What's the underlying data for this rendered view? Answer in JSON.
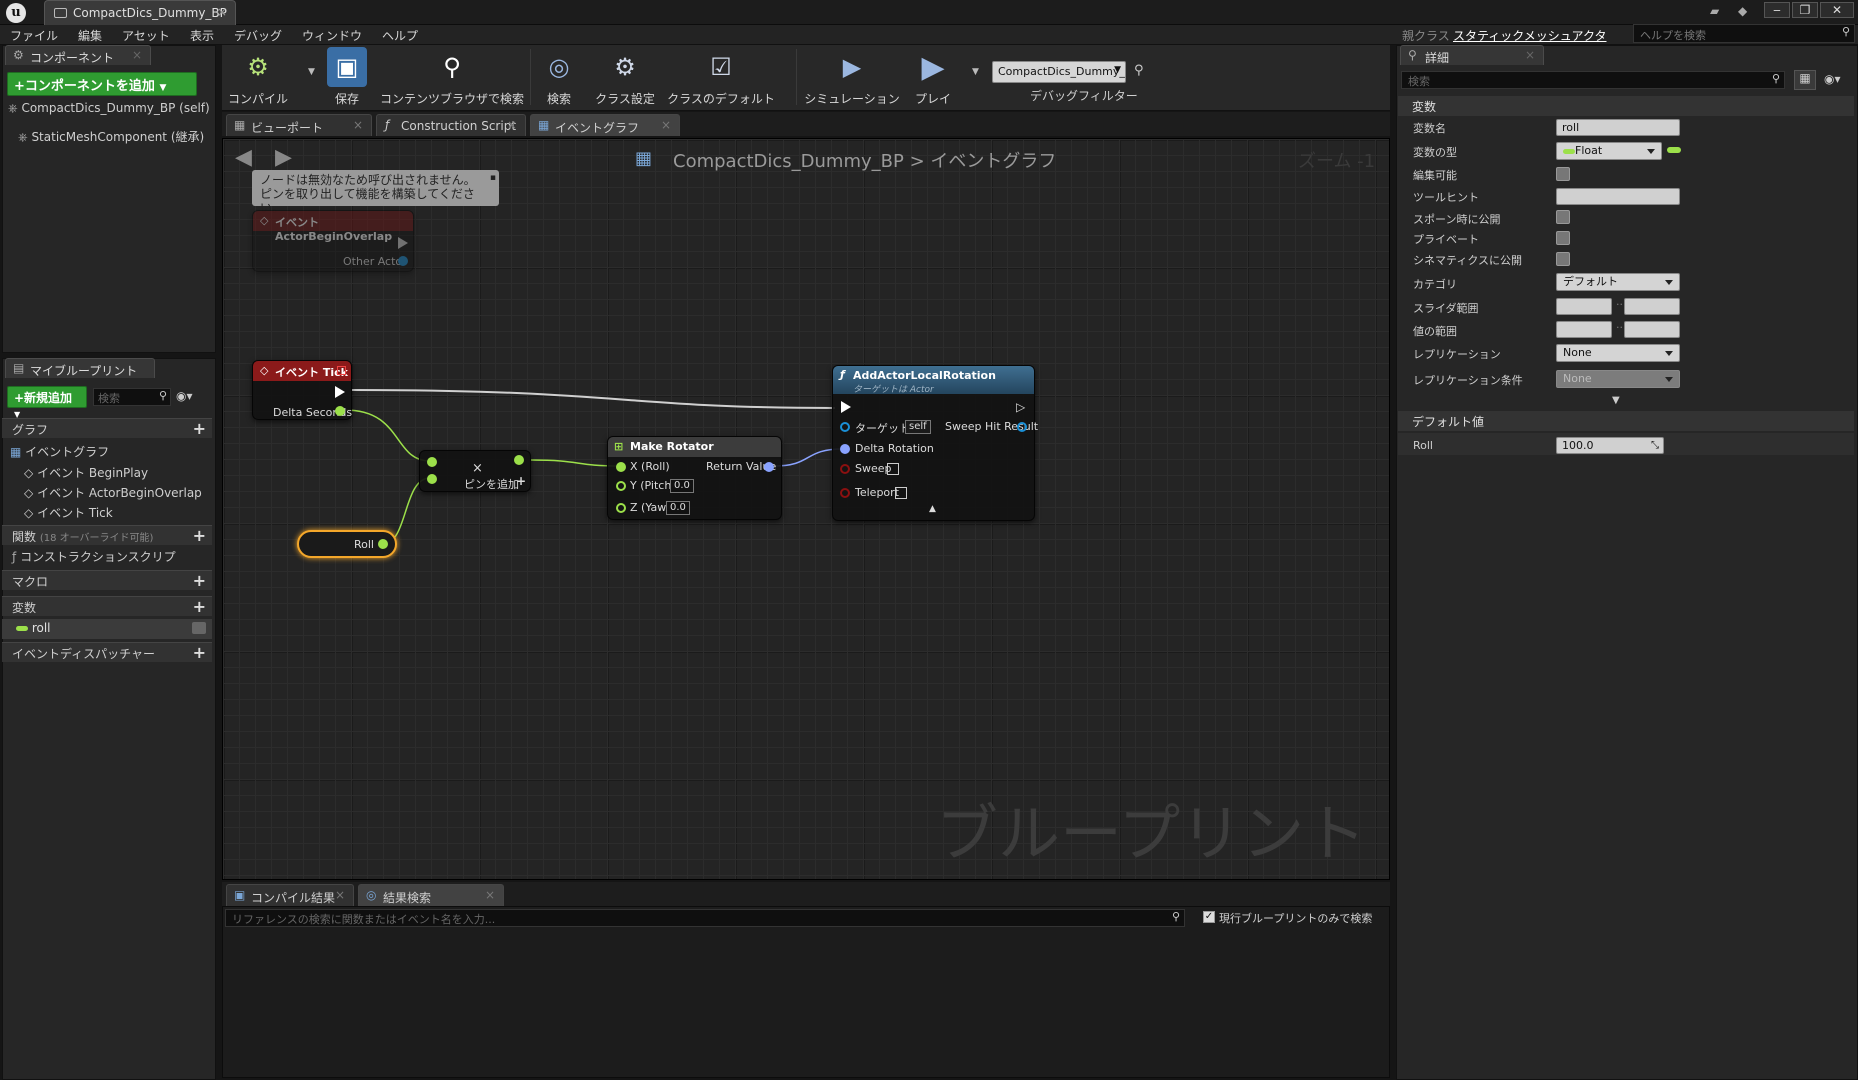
{
  "window": {
    "tab_title": "CompactDics_Dummy_BP",
    "tab_close": "×",
    "parent_class_label": "親クラス",
    "parent_class_value": "スタティックメッシュアクタ",
    "help_search_placeholder": "ヘルプを検索"
  },
  "menu": [
    "ファイル",
    "編集",
    "アセット",
    "表示",
    "デバッグ",
    "ウィンドウ",
    "ヘルプ"
  ],
  "components": {
    "tab": "コンポーネント",
    "add_button": "+コンポーネントを追加",
    "items": [
      "CompactDics_Dummy_BP (self)",
      "StaticMeshComponent (継承)"
    ]
  },
  "my_blueprint": {
    "tab": "マイブループリント",
    "add_new": "+新規追加",
    "search_placeholder": "検索",
    "graph_section": "グラフ",
    "event_graph": "イベントグラフ",
    "events": [
      "イベント BeginPlay",
      "イベント ActorBeginOverlap",
      "イベント Tick"
    ],
    "functions_section": "関数",
    "functions_note": "(18 オーバーライド可能)",
    "construction_script": "コンストラクションスクリプ",
    "macros_section": "マクロ",
    "variables_section": "変数",
    "variable_roll": "roll",
    "dispatchers_section": "イベントディスパッチャー"
  },
  "toolbar": {
    "compile": "コンパイル",
    "save": "保存",
    "content_browser": "コンテンツブラウザで検索",
    "search": "検索",
    "class_settings": "クラス設定",
    "class_defaults": "クラスのデフォルト",
    "simulation": "シミュレーション",
    "play": "プレイ",
    "debug_object": "CompactDics_Dummy_BP",
    "debug_filter": "デバッグフィルター"
  },
  "graph_tabs": [
    "ビューポート",
    "Construction Script",
    "イベントグラフ"
  ],
  "graph": {
    "breadcrumb_bp": "CompactDics_Dummy_BP",
    "breadcrumb_sep": ">",
    "breadcrumb_graph": "イベントグラフ",
    "zoom": "ズーム -1",
    "watermark": "ブループリント",
    "comment_line1": "ノードは無効なため呼び出されません。",
    "comment_line2": "ピンを取り出して機能を構築してください。",
    "node_overlap_title": "イベント ActorBeginOverlap",
    "node_overlap_pin": "Other Actor",
    "node_tick_title": "イベント Tick",
    "node_tick_pin": "Delta Seconds",
    "add_node_label": "ピンを追加",
    "roll_node": "Roll",
    "make_rotator_title": "Make Rotator",
    "make_rotator_x": "X (Roll)",
    "make_rotator_y": "Y (Pitch)",
    "make_rotator_z": "Z (Yaw)",
    "make_rotator_y_val": "0.0",
    "make_rotator_z_val": "0.0",
    "make_rotator_out": "Return Value",
    "alr_title": "AddActorLocalRotation",
    "alr_subtitle": "ターゲットは Actor",
    "alr_target": "ターゲット",
    "alr_self": "self",
    "alr_sweep_hit": "Sweep Hit Result",
    "alr_delta": "Delta Rotation",
    "alr_sweep": "Sweep",
    "alr_teleport": "Teleport"
  },
  "results": {
    "tabs": [
      "コンパイル結果",
      "結果検索"
    ],
    "search_placeholder": "リファレンスの検索に関数またはイベント名を入力...",
    "current_only": "現行ブループリントのみで検索"
  },
  "details": {
    "tab": "詳細",
    "search_placeholder": "検索",
    "variable_section": "変数",
    "var_name_label": "変数名",
    "var_name_value": "roll",
    "var_type_label": "変数の型",
    "var_type_value": "Float",
    "editable_label": "編集可能",
    "tooltip_label": "ツールヒント",
    "spawn_label": "スポーン時に公開",
    "private_label": "プライベート",
    "cinematics_label": "シネマティクスに公開",
    "category_label": "カテゴリ",
    "category_value": "デフォルト",
    "slider_label": "スライダ範囲",
    "value_range_label": "値の範囲",
    "replication_label": "レプリケーション",
    "replication_value": "None",
    "replication_cond_label": "レプリケーション条件",
    "replication_cond_value": "None",
    "defaults_section": "デフォルト値",
    "roll_label": "Roll",
    "roll_value": "100.0"
  },
  "colors": {
    "accent_green": "#2f9c31",
    "event_red": "#8b1a1a",
    "function_blue": "#2c5a7a",
    "float_pin": "#9ce04a",
    "struct_pin": "#8aa3ff"
  }
}
